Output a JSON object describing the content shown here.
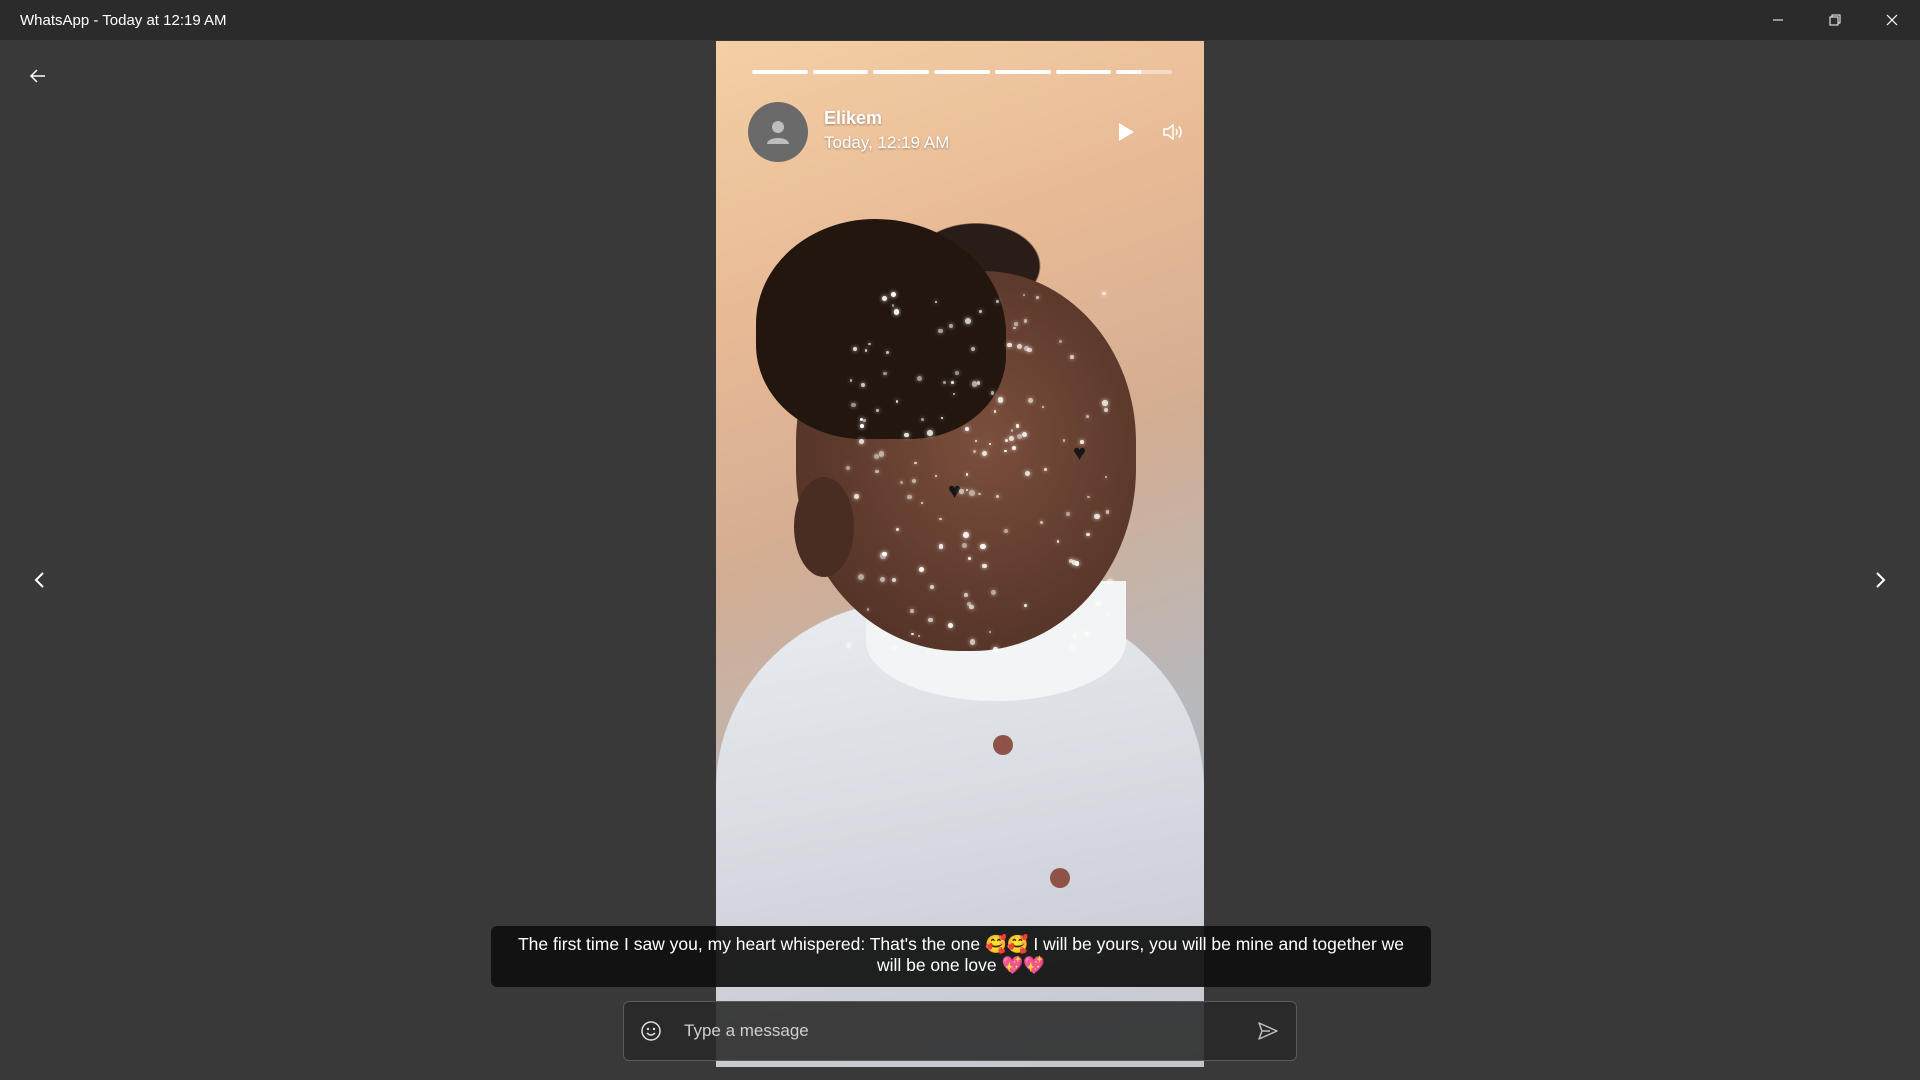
{
  "window": {
    "title": "WhatsApp - Today at 12:19 AM",
    "controls": {
      "minimize_icon": "minimize-icon",
      "restore_icon": "restore-icon",
      "close_icon": "close-icon"
    }
  },
  "status": {
    "segment_count": 7,
    "segments_complete": 6,
    "current_segment_progress": 0.45,
    "contact_name": "Elikem",
    "timestamp": "Today, 12:19 AM",
    "caption": "The first time I saw you, my heart whispered: That's the one 🥰🥰 I will be yours, you will be mine and together we will be one love 💖💖"
  },
  "composer": {
    "placeholder": "Type a message",
    "value": ""
  },
  "icons": {
    "back": "arrow-left-icon",
    "prev": "chevron-left-icon",
    "next": "chevron-right-icon",
    "play": "play-icon",
    "volume": "volume-icon",
    "emoji": "smiley-icon",
    "send": "send-icon",
    "avatar": "default-avatar-icon"
  },
  "colors": {
    "background": "#393939",
    "titlebar": "#2b2b2b",
    "caption_bg": "#0f0f0f"
  }
}
